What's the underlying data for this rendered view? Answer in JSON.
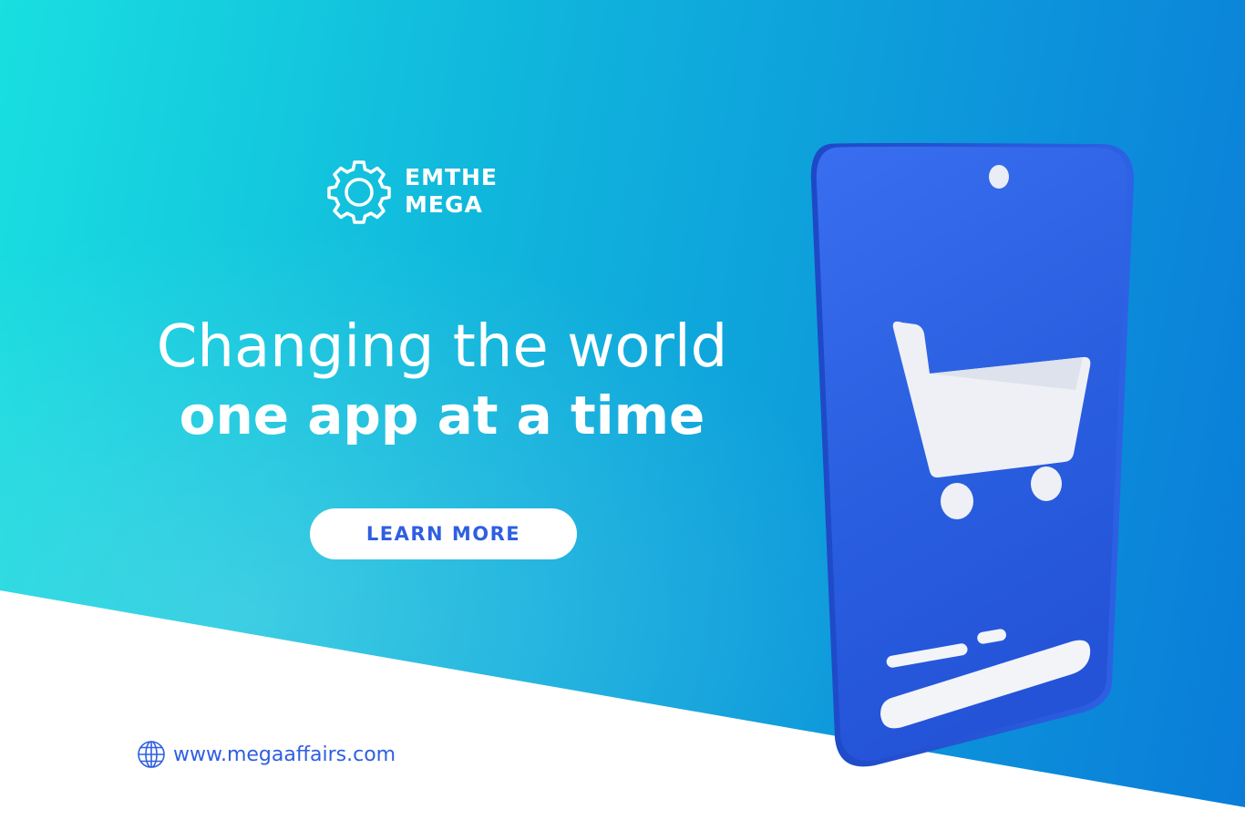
{
  "brand": {
    "line1": "EMTHE",
    "line2": "MEGA",
    "icon": "gear-icon"
  },
  "headline": {
    "line1": "Changing the world",
    "line2": "one app at a time"
  },
  "cta": {
    "label": "LEARN MORE"
  },
  "footer": {
    "website": "www.megaaffairs.com",
    "icon": "globe-icon"
  },
  "illustration": {
    "device": "phone",
    "screen_icon": "shopping-cart-icon"
  },
  "colors": {
    "gradient_start": "#19dfe0",
    "gradient_end": "#0a7cd8",
    "accent": "#2f5fe0",
    "phone_body": "#2b5fe0",
    "text_light": "#ffffff"
  }
}
